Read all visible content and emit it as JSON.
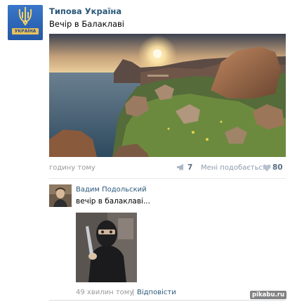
{
  "post": {
    "author": "Типова Україна",
    "avatar_banner": "УКРАЇНА",
    "text": "Вечір в Балаклаві",
    "time_ago": "годину тому",
    "share_count": "7",
    "like_label": "Мені подобається",
    "like_count": "80"
  },
  "comment": {
    "author": "Вадим Подольский",
    "text": "вечір в балаклаві...",
    "time_ago": "49 хвилин тому",
    "divider": "|",
    "reply_label": "Відповісти"
  },
  "watermark": "pikabu.ru",
  "colors": {
    "link": "#2b587a",
    "meta": "#999999",
    "separator": "#e7e8ec"
  },
  "icons": [
    "trident-icon",
    "megaphone-icon",
    "heart-icon"
  ]
}
